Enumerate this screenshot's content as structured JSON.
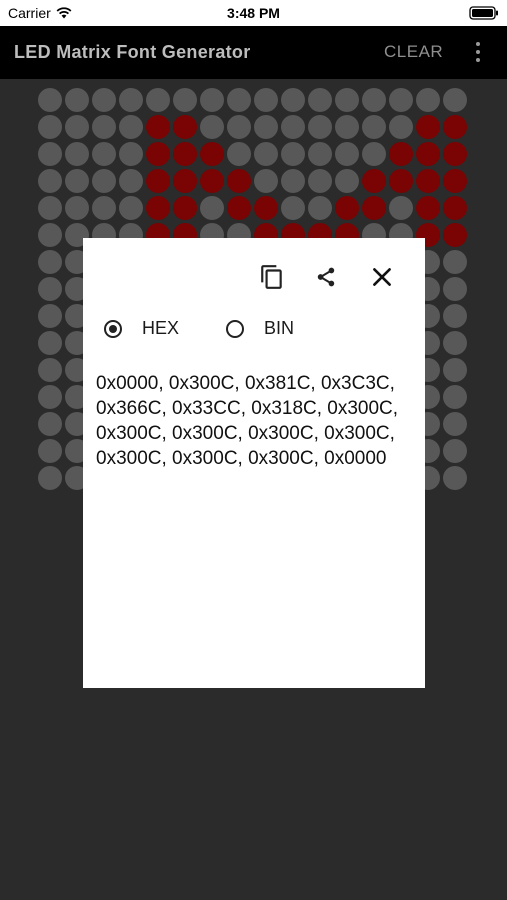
{
  "status_bar": {
    "carrier": "Carrier",
    "time": "3:48 PM"
  },
  "app_bar": {
    "title": "LED Matrix Font Generator",
    "clear_label": "CLEAR"
  },
  "matrix": {
    "columns": 16,
    "rows": 15,
    "on_color": "#7a0303",
    "off_color": "#585858",
    "visible_row_values": [
      "0x0000",
      "0x300C",
      "0x381C",
      "0x3C3C",
      "0x366C",
      "0x33CC"
    ]
  },
  "dialog": {
    "icons": [
      "copy-icon",
      "share-icon",
      "close-icon"
    ],
    "format_options": [
      {
        "label": "HEX",
        "selected": true
      },
      {
        "label": "BIN",
        "selected": false
      }
    ],
    "output_text": "0x0000, 0x300C, 0x381C, 0x3C3C, 0x366C, 0x33CC, 0x318C, 0x300C, 0x300C, 0x300C, 0x300C, 0x300C, 0x300C, 0x300C, 0x300C, 0x0000"
  }
}
